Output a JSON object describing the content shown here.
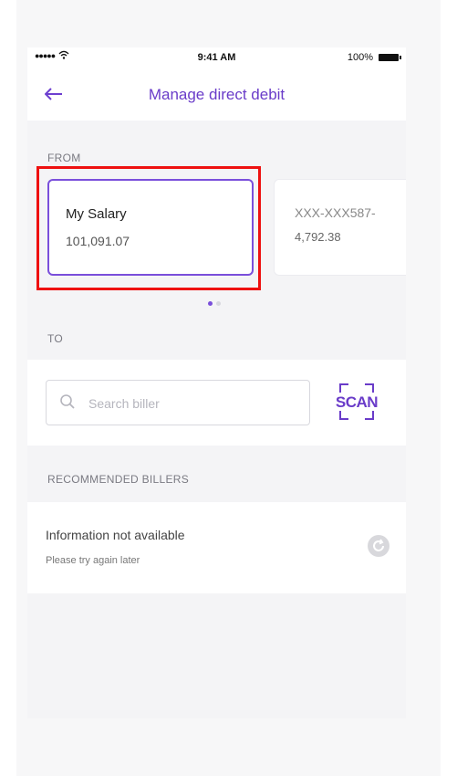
{
  "status_bar": {
    "signal": "●●●●●",
    "wifi_icon": "wifi-icon",
    "time": "9:41 AM",
    "battery": "100%"
  },
  "header": {
    "back_icon": "arrow-left-icon",
    "title": "Manage direct debit"
  },
  "from": {
    "label": "FROM",
    "accounts": [
      {
        "name": "My Salary",
        "balance": "101,091.07",
        "selected": true
      },
      {
        "name": "XXX-XXX587-",
        "balance": "4,792.38",
        "selected": false
      }
    ],
    "page_indicator": {
      "current": 1,
      "total": 2
    }
  },
  "to": {
    "label": "TO",
    "search_placeholder": "Search biller",
    "search_value": "",
    "scan_label": "SCAN"
  },
  "recommended": {
    "label": "RECOMMENDED BILLERS",
    "message": "Information not available",
    "sub_message": "Please try again later",
    "refresh_icon": "refresh-icon"
  },
  "colors": {
    "accent": "#6a3cc9",
    "highlight": "#ee1111"
  }
}
